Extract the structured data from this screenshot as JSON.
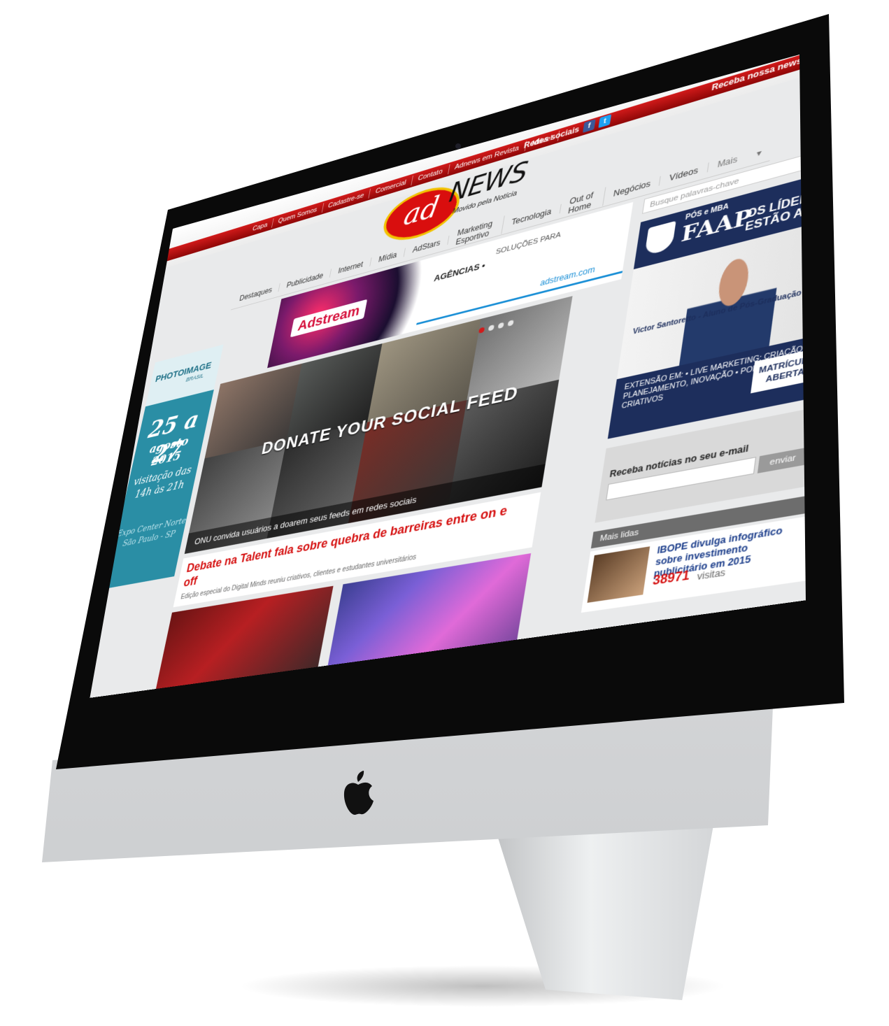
{
  "site": {
    "logo_ad": "ad",
    "logo_news": "NEWS",
    "tagline": "Movido pela Notícia"
  },
  "top_nav": [
    "Capa",
    "Quem Somos",
    "Cadastre-se",
    "Comercial",
    "Contato",
    "Adnews em Revista",
    "Móvel"
  ],
  "social": {
    "label": "Redes sociais",
    "facebook_icon": "f",
    "twitter_icon": "t"
  },
  "newsletter_link": {
    "label": "Receba nossa newsletter"
  },
  "main_nav": [
    "Destaques",
    "Publicidade",
    "Internet",
    "Mídia",
    "AdStars",
    "Marketing Esportivo",
    "Tecnologia",
    "Out of Home",
    "Negócios",
    "Vídeos",
    "Mais"
  ],
  "search": {
    "placeholder": "Busque palavras-chave"
  },
  "ad_adstream": {
    "brand": "Adstream",
    "line1": "SOLUÇÕES PARA",
    "line2": "AGÊNCIAS •",
    "url": "adstream.com"
  },
  "ad_photoimage": {
    "logo": "PHOTOIMAGE",
    "sub": "BRASIL",
    "dates": "25 a 27",
    "month": "agosto 2015",
    "visit": "visitação das 14h às 21h",
    "place": "Expo Center Norte São Paulo - SP"
  },
  "hero": {
    "headline": "DONATE YOUR SOCIAL FEED",
    "caption": "ONU convida usuários a doarem seus feeds em redes sociais",
    "slides_total": 4,
    "slide_active": 1
  },
  "article": {
    "title": "Debate na Talent fala sobre quebra de barreiras entre on e off",
    "summary": "Edição especial do Digital Minds reuniu criativos, clientes e estudantes universitários"
  },
  "ad_faap": {
    "pos": "PÓS e MBA",
    "name": "FAAP",
    "lead": "OS LÍDERES ESTÃO AQUI.",
    "caption": "Victor Santoretto - Aluno de Pós-Graduação FAAP",
    "ext": "EXTENSÃO EM: • LIVE MARKETING: CRIAÇÃO, PLANEJAMENTO, INOVAÇÃO • PORTFÓLIO PARA CRIATIVOS",
    "cta": "MATRÍCULAS ABERTAS"
  },
  "newsletter_box": {
    "title": "Receba notícias no seu e-mail",
    "button": "enviar"
  },
  "mais_lidas": {
    "title": "Mais lidas",
    "item_title": "IBOPE divulga infográfico sobre investimento publicitário em 2015",
    "visits": "38971",
    "visits_label": "visitas"
  },
  "colors": {
    "brand_red": "#d11a1a",
    "faap_blue": "#1d2e5c",
    "photoimage_teal": "#2a8ea5"
  }
}
